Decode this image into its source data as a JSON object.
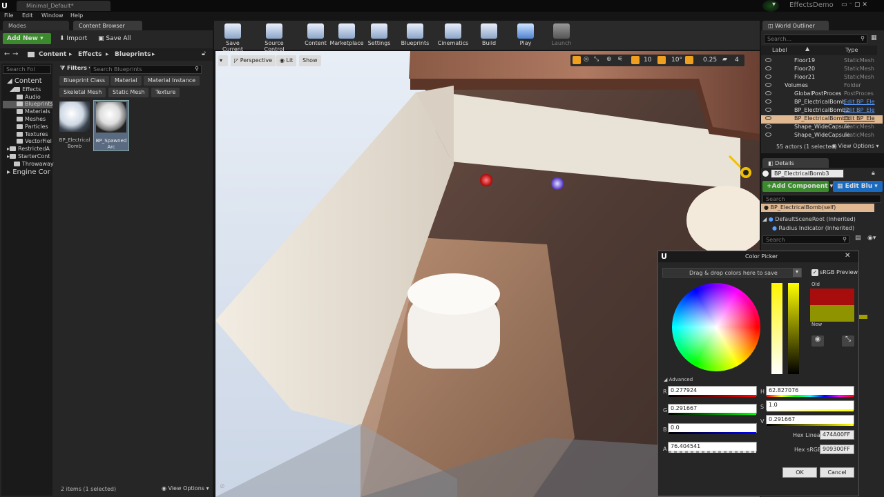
{
  "titlebar": {
    "tab_title": "Minimal_Default*",
    "project": "EffectsDemo"
  },
  "menu": [
    "File",
    "Edit",
    "Window",
    "Help"
  ],
  "left_tabs": {
    "modes": "Modes",
    "content_browser": "Content Browser"
  },
  "content_browser": {
    "add_new": "Add New",
    "import": "Import",
    "save_all": "Save All",
    "breadcrumb": [
      "Content",
      "Effects",
      "Blueprints"
    ],
    "search_folders_placeholder": "Search Fol",
    "filters_label": "Filters",
    "search_blueprints_placeholder": "Search Blueprints",
    "filter_chips": [
      "Blueprint Class",
      "Material",
      "Material Instance",
      "Skeletal Mesh",
      "Static Mesh",
      "Texture"
    ],
    "tree": [
      "Content",
      "Effects",
      "Audio",
      "Blueprints",
      "Materials",
      "Meshes",
      "Particles",
      "Textures",
      "VectorFiel",
      "RestrictedA",
      "StarterCont",
      "Throwaway",
      "Engine Cor"
    ],
    "assets": [
      {
        "name": "BP_Electrical Bomb"
      },
      {
        "name": "BP_Spawned Arc"
      }
    ],
    "status": "2 items (1 selected)",
    "view_options": "View Options"
  },
  "toolbar": [
    "Save Current",
    "Source Control",
    "Content",
    "Marketplace",
    "Settings",
    "Blueprints",
    "Cinematics",
    "Build",
    "Play",
    "Launch"
  ],
  "viewport": {
    "perspective": "Perspective",
    "lit": "Lit",
    "show": "Show",
    "grid_snap": "10",
    "rot_snap": "10°",
    "scale_snap": "0.25",
    "cam_speed": "4"
  },
  "world_outliner": {
    "tab": "World Outliner",
    "search_placeholder": "Search...",
    "col_label": "Label",
    "col_type": "Type",
    "rows": [
      {
        "label": "Floor19",
        "type": "StaticMesh"
      },
      {
        "label": "Floor20",
        "type": "StaticMesh"
      },
      {
        "label": "Floor21",
        "type": "StaticMesh"
      },
      {
        "label": "Volumes",
        "type": "Folder"
      },
      {
        "label": "GlobalPostProces",
        "type": "PostProces"
      },
      {
        "label": "BP_ElectricalBomb",
        "type": "Edit BP_Ele"
      },
      {
        "label": "BP_ElectricalBomb2",
        "type": "Edit BP_Ele"
      },
      {
        "label": "BP_ElectricalBomb3",
        "type": "Edit BP_Ele"
      },
      {
        "label": "Shape_WideCapsule",
        "type": "StaticMesh"
      },
      {
        "label": "Shape_WideCapsule",
        "type": "StaticMesh"
      }
    ],
    "status": "55 actors (1 selected)",
    "view_options": "View Options"
  },
  "details": {
    "tab": "Details",
    "name_value": "BP_ElectricalBomb3",
    "add_component": "Add Component",
    "edit_blueprint": "Edit Blu",
    "search_placeholder": "Search",
    "components": [
      "BP_ElectricalBomb(self)",
      "DefaultSceneRoot (Inherited)",
      "Radius Indicator (Inherited)"
    ],
    "search2_placeholder": "Search"
  },
  "color_picker": {
    "title": "Color Picker",
    "drop_hint": "Drag & drop colors here to save",
    "srgb_label": "sRGB Preview",
    "old_label": "Old",
    "new_label": "New",
    "old_color": "#a80d0d",
    "new_color": "#909300",
    "advanced_label": "Advanced",
    "r_label": "R",
    "r_value": "0.277924",
    "g_label": "G",
    "g_value": "0.291667",
    "b_label": "B",
    "b_value": "0.0",
    "a_label": "A",
    "a_value": "76.404541",
    "h_label": "H",
    "h_value": "62.827076",
    "s_label": "S",
    "s_value": "1.0",
    "v_label": "V",
    "v_value": "0.291667",
    "hex_linear_label": "Hex Linear",
    "hex_linear_value": "474A00FF",
    "hex_srgb_label": "Hex sRGB",
    "hex_srgb_value": "909300FF",
    "ok": "OK",
    "cancel": "Cancel"
  }
}
